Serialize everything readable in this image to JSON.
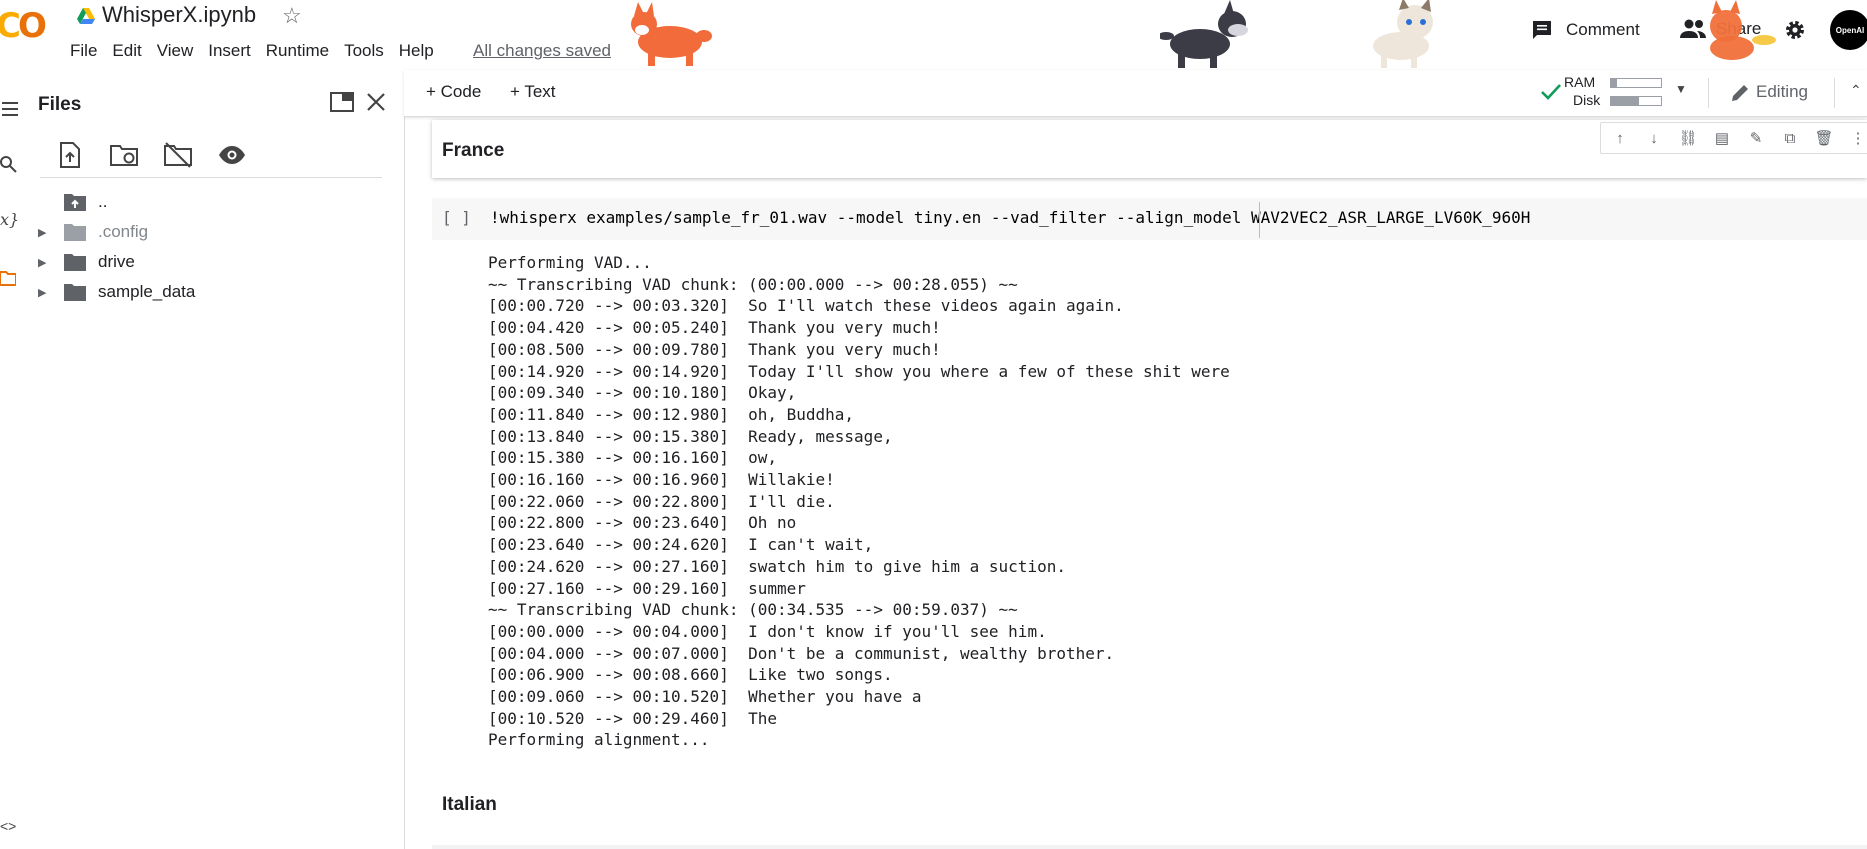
{
  "header": {
    "title": "WhisperX.ipynb",
    "saved_status": "All changes saved",
    "menu": [
      "File",
      "Edit",
      "View",
      "Insert",
      "Runtime",
      "Tools",
      "Help"
    ],
    "comment_label": "Comment",
    "share_label": "Share",
    "avatar_text": "OpenAI",
    "brand_colors": {
      "logo_yellow": "#f9ab00",
      "logo_orange": "#e8710a"
    }
  },
  "sidebar": {
    "title": "Files",
    "tree": [
      {
        "label": "..",
        "type": "parent"
      },
      {
        "label": ".config",
        "type": "folder",
        "muted": true
      },
      {
        "label": "drive",
        "type": "folder"
      },
      {
        "label": "sample_data",
        "type": "folder"
      }
    ]
  },
  "toolbar": {
    "code_label": "+ Code",
    "text_label": "+ Text",
    "ram_label": "RAM",
    "disk_label": "Disk",
    "ram_fraction": 0.12,
    "disk_fraction": 0.55,
    "editing_label": "Editing",
    "connected_color": "#0f9d58"
  },
  "notebook": {
    "section1_title": "France",
    "run_bracket": "[ ]",
    "code": "!whisperx examples/sample_fr_01.wav --model tiny.en --vad_filter --align_model WAV2VEC2_ASR_LARGE_LV60K_960H",
    "output_lines": [
      "Performing VAD...",
      "~~ Transcribing VAD chunk: (00:00.000 --> 00:28.055) ~~",
      "[00:00.720 --> 00:03.320]  So I'll watch these videos again again.",
      "[00:04.420 --> 00:05.240]  Thank you very much!",
      "[00:08.500 --> 00:09.780]  Thank you very much!",
      "[00:14.920 --> 00:14.920]  Today I'll show you where a few of these shit were",
      "[00:09.340 --> 00:10.180]  Okay,",
      "[00:11.840 --> 00:12.980]  oh, Buddha,",
      "[00:13.840 --> 00:15.380]  Ready, message,",
      "[00:15.380 --> 00:16.160]  ow,",
      "[00:16.160 --> 00:16.960]  Willakie!",
      "[00:22.060 --> 00:22.800]  I'll die.",
      "[00:22.800 --> 00:23.640]  Oh no",
      "[00:23.640 --> 00:24.620]  I can't wait,",
      "[00:24.620 --> 00:27.160]  swatch him to give him a suction.",
      "[00:27.160 --> 00:29.160]  summer",
      "~~ Transcribing VAD chunk: (00:34.535 --> 00:59.037) ~~",
      "[00:00.000 --> 00:04.000]  I don't know if you'll see him.",
      "[00:04.000 --> 00:07.000]  Don't be a communist, wealthy brother.",
      "[00:06.900 --> 00:08.660]  Like two songs.",
      "[00:09.060 --> 00:10.520]  Whether you have a",
      "[00:10.520 --> 00:29.460]  The",
      "Performing alignment..."
    ],
    "section2_title": "Italian"
  }
}
